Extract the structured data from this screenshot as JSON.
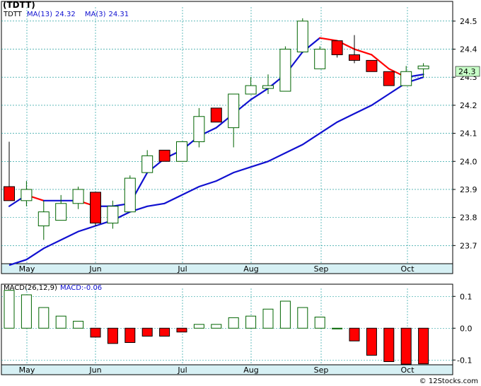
{
  "header": {
    "ticker_title": "(TDTT)",
    "ticker": "TDTT",
    "ma13_label": "MA(13)",
    "ma13_value": "24.32",
    "ma3_label": "MA(3)",
    "ma3_value": "24.31"
  },
  "macd_header": {
    "label": "MACD(26,12,9)",
    "value_label": "MACD:-0.06"
  },
  "last_price_badge": "24.3",
  "watermark": "© 12Stocks.com",
  "colors": {
    "up": "#006400",
    "down": "#ff0000",
    "ma13": "#1010d0",
    "ma3_up": "#1010d0",
    "ma3_down": "#ff0000",
    "grid": "#009090",
    "axis_strip": "#d6f0f4",
    "badge_bg": "#c8ffc8"
  },
  "chart_data": [
    {
      "type": "candlestick",
      "title": "",
      "x_ticks": [
        "May",
        "Jun",
        "Jul",
        "Aug",
        "Sep",
        "Oct"
      ],
      "y_ticks": [
        23.7,
        23.8,
        23.9,
        24.0,
        24.1,
        24.2,
        24.3,
        24.4,
        24.5
      ],
      "ylim": [
        23.6,
        24.55
      ],
      "grid": true,
      "candles": [
        {
          "o": 23.91,
          "h": 24.07,
          "l": 23.86,
          "c": 23.86
        },
        {
          "o": 23.86,
          "h": 23.93,
          "l": 23.84,
          "c": 23.9
        },
        {
          "o": 23.77,
          "h": 23.86,
          "l": 23.72,
          "c": 23.82
        },
        {
          "o": 23.79,
          "h": 23.88,
          "l": 23.79,
          "c": 23.85
        },
        {
          "o": 23.85,
          "h": 23.91,
          "l": 23.83,
          "c": 23.9
        },
        {
          "o": 23.89,
          "h": 23.89,
          "l": 23.77,
          "c": 23.78
        },
        {
          "o": 23.78,
          "h": 23.86,
          "l": 23.76,
          "c": 23.84
        },
        {
          "o": 23.82,
          "h": 23.95,
          "l": 23.82,
          "c": 23.94
        },
        {
          "o": 23.96,
          "h": 24.04,
          "l": 23.96,
          "c": 24.02
        },
        {
          "o": 24.04,
          "h": 24.04,
          "l": 24.0,
          "c": 24.0
        },
        {
          "o": 24.0,
          "h": 24.07,
          "l": 24.0,
          "c": 24.07
        },
        {
          "o": 24.07,
          "h": 24.19,
          "l": 24.05,
          "c": 24.16
        },
        {
          "o": 24.19,
          "h": 24.19,
          "l": 24.14,
          "c": 24.14
        },
        {
          "o": 24.12,
          "h": 24.24,
          "l": 24.05,
          "c": 24.24
        },
        {
          "o": 24.24,
          "h": 24.3,
          "l": 24.24,
          "c": 24.27
        },
        {
          "o": 24.26,
          "h": 24.31,
          "l": 24.24,
          "c": 24.27
        },
        {
          "o": 24.25,
          "h": 24.41,
          "l": 24.25,
          "c": 24.4
        },
        {
          "o": 24.39,
          "h": 24.51,
          "l": 24.39,
          "c": 24.5
        },
        {
          "o": 24.33,
          "h": 24.41,
          "l": 24.33,
          "c": 24.4
        },
        {
          "o": 24.43,
          "h": 24.43,
          "l": 24.37,
          "c": 24.38
        },
        {
          "o": 24.38,
          "h": 24.45,
          "l": 24.35,
          "c": 24.36
        },
        {
          "o": 24.36,
          "h": 24.36,
          "l": 24.32,
          "c": 24.32
        },
        {
          "o": 24.32,
          "h": 24.32,
          "l": 24.27,
          "c": 24.27
        },
        {
          "o": 24.27,
          "h": 24.34,
          "l": 24.27,
          "c": 24.32
        },
        {
          "o": 24.33,
          "h": 24.35,
          "l": 24.3,
          "c": 24.34
        }
      ],
      "ma13": [
        23.63,
        23.65,
        23.69,
        23.72,
        23.75,
        23.77,
        23.79,
        23.82,
        23.84,
        23.85,
        23.88,
        23.91,
        23.93,
        23.96,
        23.98,
        24.0,
        24.03,
        24.06,
        24.1,
        24.14,
        24.17,
        24.2,
        24.24,
        24.28,
        24.3
      ],
      "ma3": [
        23.84,
        23.88,
        23.86,
        23.86,
        23.86,
        23.84,
        23.84,
        23.85,
        23.96,
        24.01,
        24.04,
        24.09,
        24.12,
        24.17,
        24.22,
        24.26,
        24.31,
        24.39,
        24.44,
        24.43,
        24.4,
        24.38,
        24.33,
        24.3,
        24.31
      ]
    },
    {
      "type": "bar",
      "title": "MACD(26,12,9)",
      "y_ticks": [
        0.1,
        0.0,
        -0.1
      ],
      "ylim": [
        -0.115,
        0.125
      ],
      "values": [
        0.119,
        0.105,
        0.065,
        0.038,
        0.022,
        -0.028,
        -0.048,
        -0.045,
        -0.025,
        -0.025,
        -0.012,
        0.012,
        0.012,
        0.033,
        0.038,
        0.06,
        0.085,
        0.065,
        0.035,
        0.0,
        -0.04,
        -0.085,
        -0.105,
        -0.113,
        -0.112
      ]
    }
  ]
}
